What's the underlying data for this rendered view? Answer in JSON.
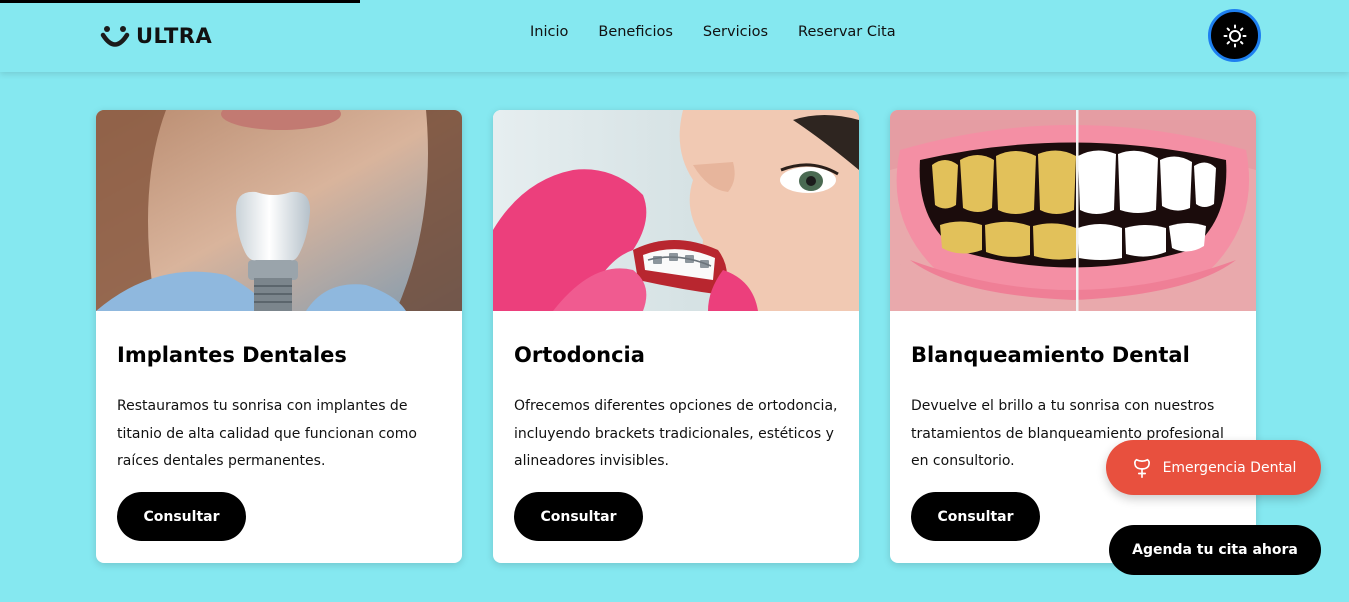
{
  "header": {
    "logo_text": "ULTRA",
    "logo_icon": "smile-icon",
    "nav": [
      "Inicio",
      "Beneficios",
      "Servicios",
      "Reservar Cita"
    ],
    "theme_toggle_icon": "sun-icon"
  },
  "services": [
    {
      "image": "dental-implant-photo",
      "title": "Implantes Dentales",
      "description": "Restauramos tu sonrisa con implantes de titanio de alta calidad que funcionan como raíces dentales permanentes.",
      "button": "Consultar"
    },
    {
      "image": "orthodontic-braces-photo",
      "title": "Ortodoncia",
      "description": "Ofrecemos diferentes opciones de ortodoncia, incluyendo brackets tradicionales, estéticos y alineadores invisibles.",
      "button": "Consultar"
    },
    {
      "image": "teeth-whitening-before-after-photo",
      "title": "Blanqueamiento Dental",
      "description": "Devuelve el brillo a tu sonrisa con nuestros tratamientos de blanqueamiento profesional en consultorio.",
      "button": "Consultar"
    }
  ],
  "floating": {
    "emergency_label": "Emergencia Dental",
    "emergency_icon": "tooth-icon",
    "book_label": "Agenda tu cita ahora"
  },
  "colors": {
    "background": "#85e8f0",
    "emergency": "#e8503e",
    "button": "#000000",
    "toggle_border": "#1e7ff0"
  }
}
